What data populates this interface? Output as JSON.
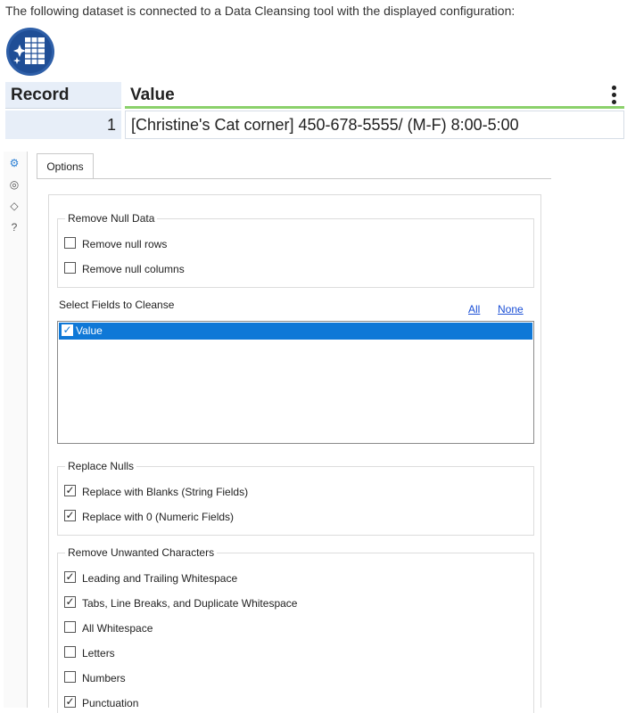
{
  "intro_text": "The following dataset is connected to a Data Cleansing tool with the displayed configuration:",
  "tool_icon": "data-cleansing-icon",
  "grid": {
    "columns": [
      "Record",
      "Value"
    ],
    "rows": [
      {
        "record": "1",
        "value": "[Christine's Cat corner] 450-678-5555/ (M-F) 8:00-5:00"
      }
    ]
  },
  "sidebar_icons": [
    "gear-icon",
    "annotation-icon",
    "tag-icon",
    "help-icon"
  ],
  "tab_label": "Options",
  "remove_null": {
    "title": "Remove Null Data",
    "rows_label": "Remove null rows",
    "rows_checked": false,
    "columns_label": "Remove null columns",
    "columns_checked": false
  },
  "fields": {
    "title": "Select Fields to Cleanse",
    "all_link": "All",
    "none_link": "None",
    "items": [
      {
        "label": "Value",
        "checked": true
      }
    ]
  },
  "replace_nulls": {
    "title": "Replace Nulls",
    "blanks_label": "Replace with Blanks (String Fields)",
    "blanks_checked": true,
    "zero_label": "Replace with 0 (Numeric Fields)",
    "zero_checked": true
  },
  "unwanted": {
    "title": "Remove Unwanted Characters",
    "items": [
      {
        "label": "Leading and Trailing Whitespace",
        "checked": true
      },
      {
        "label": "Tabs, Line Breaks, and Duplicate Whitespace",
        "checked": true
      },
      {
        "label": "All Whitespace",
        "checked": false
      },
      {
        "label": "Letters",
        "checked": false
      },
      {
        "label": "Numbers",
        "checked": false
      },
      {
        "label": "Punctuation",
        "checked": true
      }
    ]
  },
  "colors": {
    "accent": "#0f78d7",
    "grid_header": "#e7eef8",
    "value_underline": "#8bd16b"
  }
}
